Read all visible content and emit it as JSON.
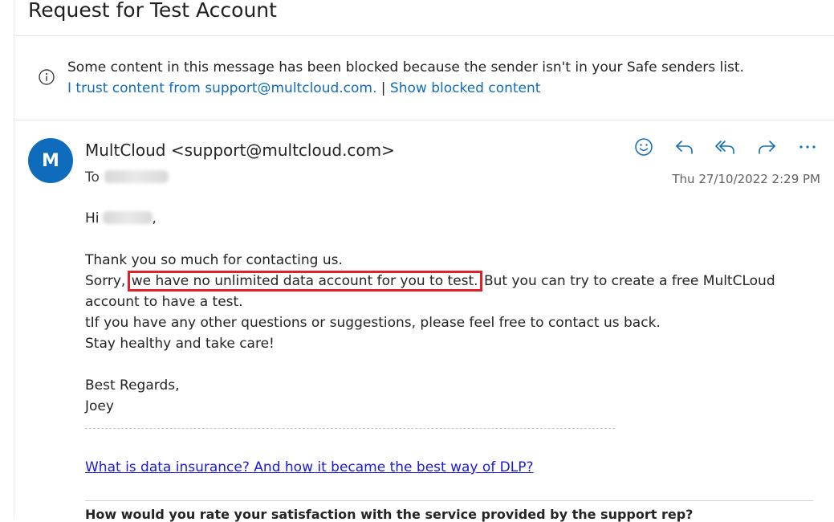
{
  "email": {
    "subject": "Request for Test Account",
    "blocked_notice": {
      "message": "Some content in this message has been blocked because the sender isn't in your Safe senders list.",
      "trust_link": "I trust content from support@multcloud.com.",
      "separator": "|",
      "show_link": "Show blocked content"
    },
    "sender": {
      "initial": "M",
      "display": "MultCloud <support@multcloud.com>",
      "to_label": "To",
      "timestamp": "Thu 27/10/2022 2:29 PM"
    },
    "actions": [
      "smiley-icon",
      "reply-icon",
      "reply-all-icon",
      "forward-icon",
      "more-icon"
    ],
    "body": {
      "greeting": "Hi",
      "greeting_suffix": ",",
      "line1": "Thank you so much for contacting us.",
      "line2_prefix": "Sorry, ",
      "line2_highlight": "we have no unlimited data account for you to test.",
      "line2_suffix": " But  you can try to create a free MultCLoud account to have a test.",
      "line3": "tIf you have any other questions or suggestions, please feel free to contact us back.",
      "line4": "Stay healthy and take care!",
      "closing": "Best Regards,",
      "signature": "Joey",
      "article_link": "What is data insurance? And how it became the best way of DLP?",
      "survey_question": "How would you rate your satisfaction with the service provided by the support rep?"
    },
    "colors": {
      "accent": "#0f6cbd",
      "highlight_box": "#e0202a",
      "link": "#1a1adb"
    }
  }
}
